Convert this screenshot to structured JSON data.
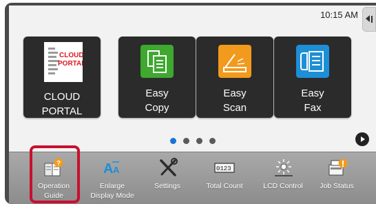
{
  "status": {
    "time": "10:15 AM"
  },
  "apps": [
    {
      "id": "cloud",
      "label_lines": [
        "CLOUD PORTAL"
      ],
      "logo_text": [
        "CLOUD",
        "PORTAL"
      ],
      "icon": "cloud-portal-logo"
    },
    {
      "id": "copy",
      "label_lines": [
        "Easy",
        "Copy"
      ],
      "icon": "copy-icon",
      "color": "#3ea82f"
    },
    {
      "id": "scan",
      "label_lines": [
        "Easy",
        "Scan"
      ],
      "icon": "scan-icon",
      "color": "#f29a1d"
    },
    {
      "id": "fax",
      "label_lines": [
        "Easy",
        "Fax"
      ],
      "icon": "fax-icon",
      "color": "#1d8fd6"
    }
  ],
  "pagination": {
    "pages": 4,
    "current": 1
  },
  "shortcuts": [
    {
      "label_lines": [
        "Operation",
        "Guide"
      ],
      "icon": "operation-guide-icon",
      "highlighted": true
    },
    {
      "label_lines": [
        "Enlarge",
        "Display Mode"
      ],
      "icon": "enlarge-display-icon"
    },
    {
      "label_lines": [
        "Settings"
      ],
      "icon": "settings-icon"
    },
    {
      "label_lines": [
        "Total Count"
      ],
      "icon": "total-count-icon",
      "counter_text": "0123"
    },
    {
      "label_lines": [
        "LCD Control"
      ],
      "icon": "lcd-control-icon"
    },
    {
      "label_lines": [
        "Job Status"
      ],
      "icon": "job-status-icon"
    }
  ],
  "colors": {
    "highlight": "#c8102e",
    "active_dot": "#1a73d9",
    "cloud_red": "#d71920"
  }
}
